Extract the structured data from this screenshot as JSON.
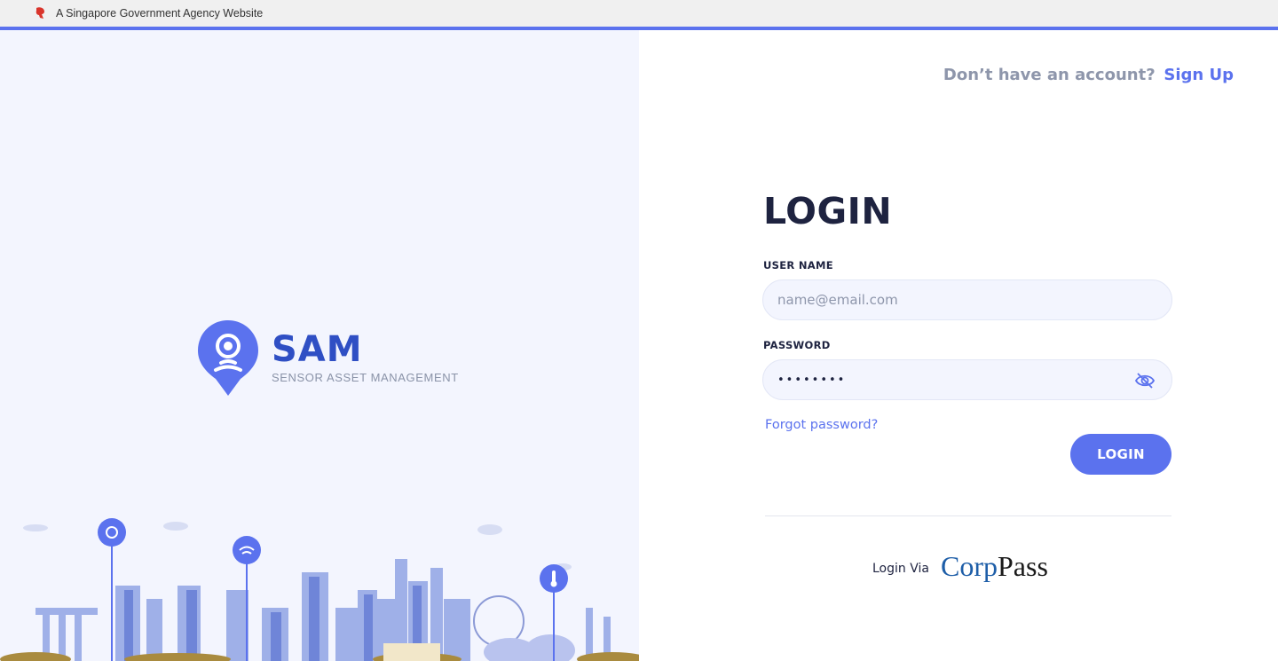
{
  "masthead": {
    "text": "A Singapore Government Agency Website",
    "icon": "singapore-lion-head-icon"
  },
  "brand": {
    "title": "SAM",
    "subtitle": "SENSOR ASSET MANAGEMENT",
    "logo_icon": "location-pin-sensor-icon"
  },
  "signup": {
    "question": "Don’t have an account?",
    "link": "Sign Up"
  },
  "login_form": {
    "title": "LOGIN",
    "username_label": "USER NAME",
    "username_placeholder": "name@email.com",
    "username_value": "",
    "password_label": "PASSWORD",
    "password_value": "••••••••",
    "password_toggle_icon": "eye-slash-icon",
    "forgot_link": "Forgot password?",
    "submit_label": "LOGIN"
  },
  "alt_login": {
    "label": "Login Via",
    "provider_a": "Corp",
    "provider_b": "Pass"
  },
  "colors": {
    "accent": "#5b72ee",
    "brand_blue": "#2f4fc4",
    "heading": "#1e2340",
    "muted": "#8e96ab",
    "left_bg": "#f3f5fe",
    "corppass_blue": "#1e5ea8"
  }
}
